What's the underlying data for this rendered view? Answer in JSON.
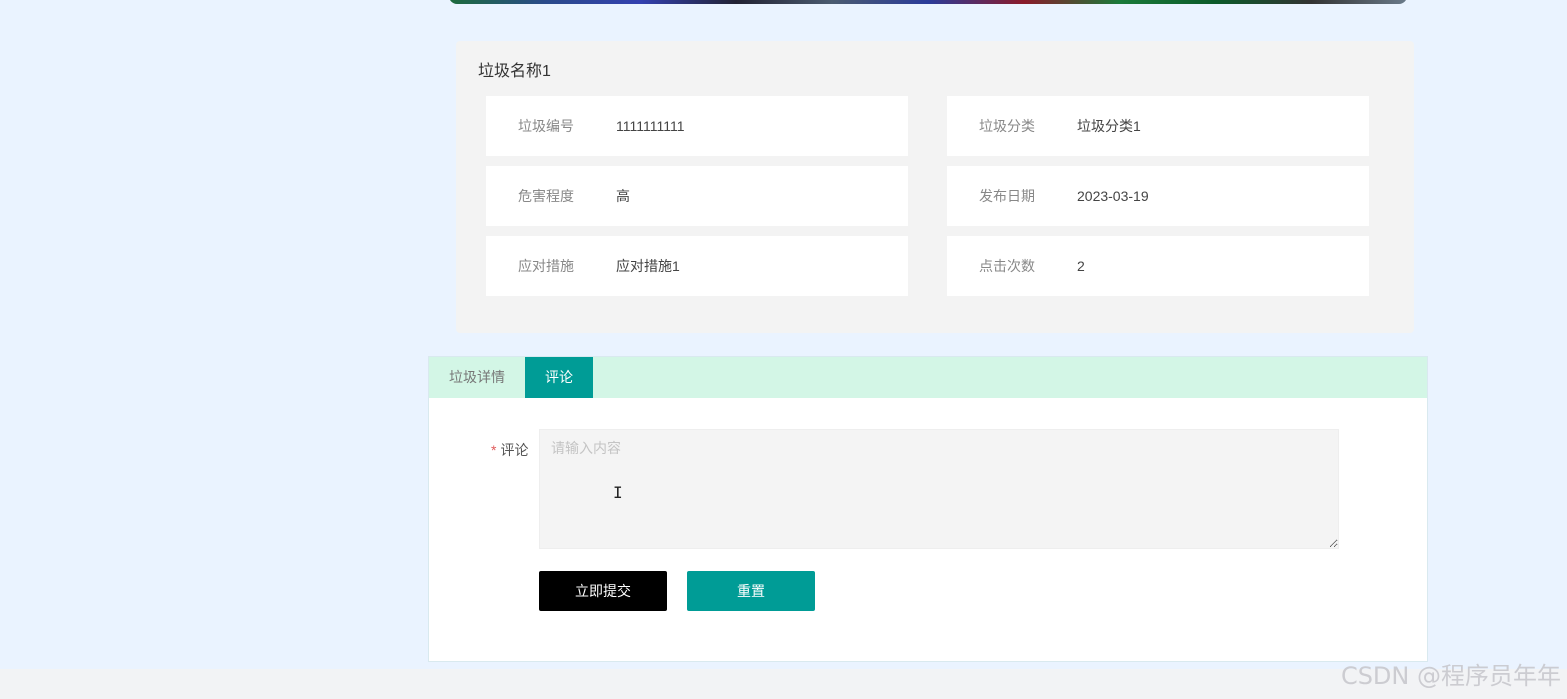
{
  "detail": {
    "title": "垃圾名称1",
    "fields": [
      {
        "label": "垃圾编号",
        "value": "1111111111"
      },
      {
        "label": "垃圾分类",
        "value": "垃圾分类1"
      },
      {
        "label": "危害程度",
        "value": "高"
      },
      {
        "label": "发布日期",
        "value": "2023-03-19"
      },
      {
        "label": "应对措施",
        "value": "应对措施1"
      },
      {
        "label": "点击次数",
        "value": "2"
      }
    ]
  },
  "tabs": [
    {
      "label": "垃圾详情",
      "active": false
    },
    {
      "label": "评论",
      "active": true
    }
  ],
  "comment_form": {
    "required_mark": "*",
    "label": "评论",
    "placeholder": "请输入内容",
    "value": "",
    "submit_label": "立即提交",
    "reset_label": "重置"
  },
  "watermark": "CSDN @程序员年年",
  "colors": {
    "accent": "#009c96",
    "tab_bar_bg": "#d3f6e6",
    "submit_bg": "#000000",
    "page_bg": "#eaf3ff"
  },
  "icons": {
    "cursor": "text-cursor-icon"
  }
}
